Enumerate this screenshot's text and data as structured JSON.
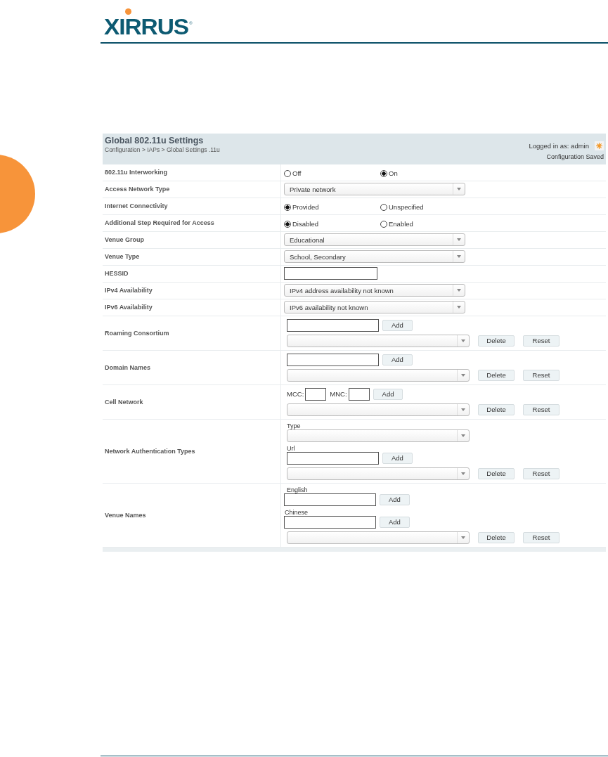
{
  "logo": {
    "text": "XIRRUS",
    "mark": "®"
  },
  "panel": {
    "title": "Global 802.11u Settings",
    "breadcrumb": "Configuration > IAPs > Global Settings .11u",
    "user": "Logged in as: admin",
    "status": "Configuration Saved"
  },
  "rows": [
    {
      "label": "802.11u Interworking",
      "kind": "radio",
      "options": [
        {
          "label": "Off",
          "selected": false
        },
        {
          "label": "On",
          "selected": true
        }
      ]
    },
    {
      "label": "Access Network Type",
      "kind": "select",
      "value": "Private network"
    },
    {
      "label": "Internet Connectivity",
      "kind": "radio",
      "options": [
        {
          "label": "Provided",
          "selected": true
        },
        {
          "label": "Unspecified",
          "selected": false
        }
      ]
    },
    {
      "label": "Additional Step Required for Access",
      "kind": "radio",
      "options": [
        {
          "label": "Disabled",
          "selected": true
        },
        {
          "label": "Enabled",
          "selected": false
        }
      ]
    },
    {
      "label": "Venue Group",
      "kind": "select",
      "value": "Educational"
    },
    {
      "label": "Venue Type",
      "kind": "select",
      "value": "School, Secondary"
    },
    {
      "label": "HESSID",
      "kind": "text"
    },
    {
      "label": "IPv4 Availability",
      "kind": "select",
      "value": "IPv4 address availability not known"
    },
    {
      "label": "IPv6 Availability",
      "kind": "select",
      "value": "IPv6 availability not known"
    },
    {
      "label": "Roaming Consortium",
      "kind": "stack",
      "lines": [
        {
          "kind": "add",
          "button": "Add"
        },
        {
          "kind": "list",
          "buttons": [
            "Delete",
            "Reset"
          ]
        }
      ]
    },
    {
      "label": "Domain Names",
      "kind": "stack",
      "lines": [
        {
          "kind": "add",
          "button": "Add"
        },
        {
          "kind": "list",
          "buttons": [
            "Delete",
            "Reset"
          ]
        }
      ]
    },
    {
      "label": "Cell Network",
      "kind": "stack",
      "lines": [
        {
          "kind": "cell",
          "mcc": "MCC:",
          "mnc": "MNC:",
          "button": "Add"
        },
        {
          "kind": "list",
          "buttons": [
            "Delete",
            "Reset"
          ]
        }
      ]
    },
    {
      "label": "Network Authentication Types",
      "kind": "stack",
      "lines": [
        {
          "kind": "caption",
          "text": "Type"
        },
        {
          "kind": "select"
        },
        {
          "kind": "caption",
          "text": "Url"
        },
        {
          "kind": "add",
          "button": "Add"
        },
        {
          "kind": "list",
          "buttons": [
            "Delete",
            "Reset"
          ]
        }
      ]
    },
    {
      "label": "Venue Names",
      "kind": "stack",
      "lines": [
        {
          "kind": "caption",
          "text": "English"
        },
        {
          "kind": "add",
          "button": "Add",
          "narrow": true
        },
        {
          "kind": "caption",
          "text": "Chinese"
        },
        {
          "kind": "add",
          "button": "Add",
          "narrow": true
        },
        {
          "kind": "list",
          "buttons": [
            "Delete",
            "Reset"
          ]
        }
      ]
    }
  ]
}
